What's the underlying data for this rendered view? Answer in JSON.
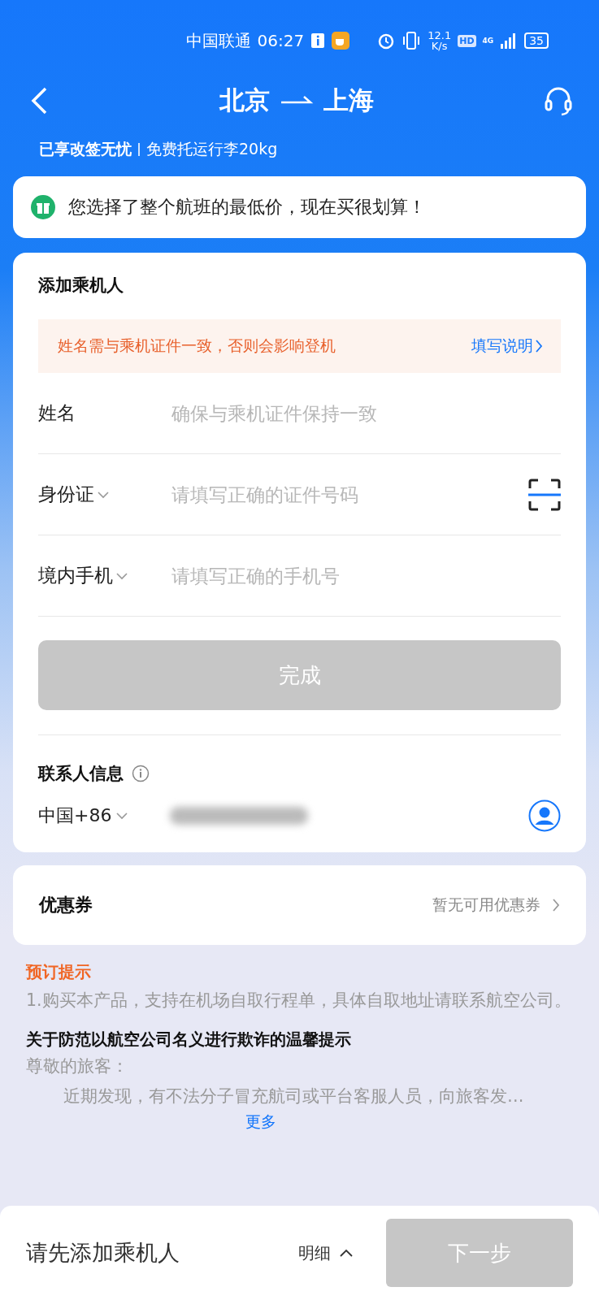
{
  "status_bar": {
    "carrier": "中国联通",
    "time": "06:27",
    "net_speed": "12.1",
    "net_speed_unit": "K/s",
    "hd": "HD",
    "network": "4G",
    "battery": "35"
  },
  "header": {
    "title_from": "北京",
    "title_to": "上海",
    "perk_bold": "已享改签无忧",
    "perk": "免费托运行李20kg"
  },
  "promo": {
    "text": "您选择了整个航班的最低价，现在买很划算！"
  },
  "passenger": {
    "title": "添加乘机人",
    "notice": "姓名需与乘机证件一致，否则会影响登机",
    "notice_link": "填写说明",
    "fields": [
      {
        "label": "姓名",
        "placeholder": "确保与乘机证件保持一致",
        "dropdown": false,
        "scan": false
      },
      {
        "label": "身份证",
        "placeholder": "请填写正确的证件号码",
        "dropdown": true,
        "scan": true
      },
      {
        "label": "境内手机",
        "placeholder": "请填写正确的手机号",
        "dropdown": true,
        "scan": false
      }
    ],
    "done_button": {
      "label": "完成",
      "disabled": true
    }
  },
  "contact": {
    "title": "联系人信息",
    "country_code": "中国+86"
  },
  "coupon": {
    "label": "优惠券",
    "value": "暂无可用优惠券"
  },
  "tips": {
    "title": "预订提示",
    "item": "1.购买本产品，支持在机场自取行程单，具体自取地址请联系航空公司。",
    "warning_title": "关于防范以航空公司名义进行欺诈的温馨提示",
    "greeting": "尊敬的旅客：",
    "body": "近期发现，有不法分子冒充航司或平台客服人员，向旅客发…",
    "more": "更多"
  },
  "bottom_bar": {
    "hint": "请先添加乘机人",
    "details": "明细",
    "next_button": {
      "label": "下一步",
      "disabled": true
    }
  }
}
